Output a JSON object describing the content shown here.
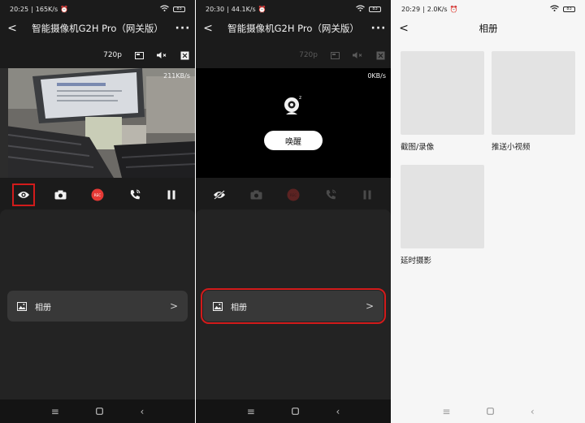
{
  "screen1": {
    "status": {
      "time": "20:25",
      "net": "165K/s",
      "battery": "83"
    },
    "title": "智能摄像机G2H Pro（网关版）",
    "quality": "720p",
    "rate": "211KB/s",
    "album_label": "相册",
    "controls": [
      "eye-icon",
      "camera-icon",
      "rec-icon",
      "phone-icon",
      "pause-icon"
    ],
    "rec_text": "REC"
  },
  "screen2": {
    "status": {
      "time": "20:30",
      "net": "44.1K/s",
      "battery": "83"
    },
    "title": "智能摄像机G2H Pro（网关版）",
    "quality": "720p",
    "rate": "0KB/s",
    "wake_label": "唤醒",
    "album_label": "相册",
    "rec_text": "REC"
  },
  "screen3": {
    "status": {
      "time": "20:29",
      "net": "2.0K/s",
      "battery": "83"
    },
    "title": "相册",
    "items": [
      {
        "label": "截图/录像"
      },
      {
        "label": "推送小视频"
      },
      {
        "label": "延时摄影"
      }
    ]
  },
  "colors": {
    "highlight": "#d21b1b",
    "rec": "#e53935",
    "dark_bg": "#1b1b1b"
  }
}
